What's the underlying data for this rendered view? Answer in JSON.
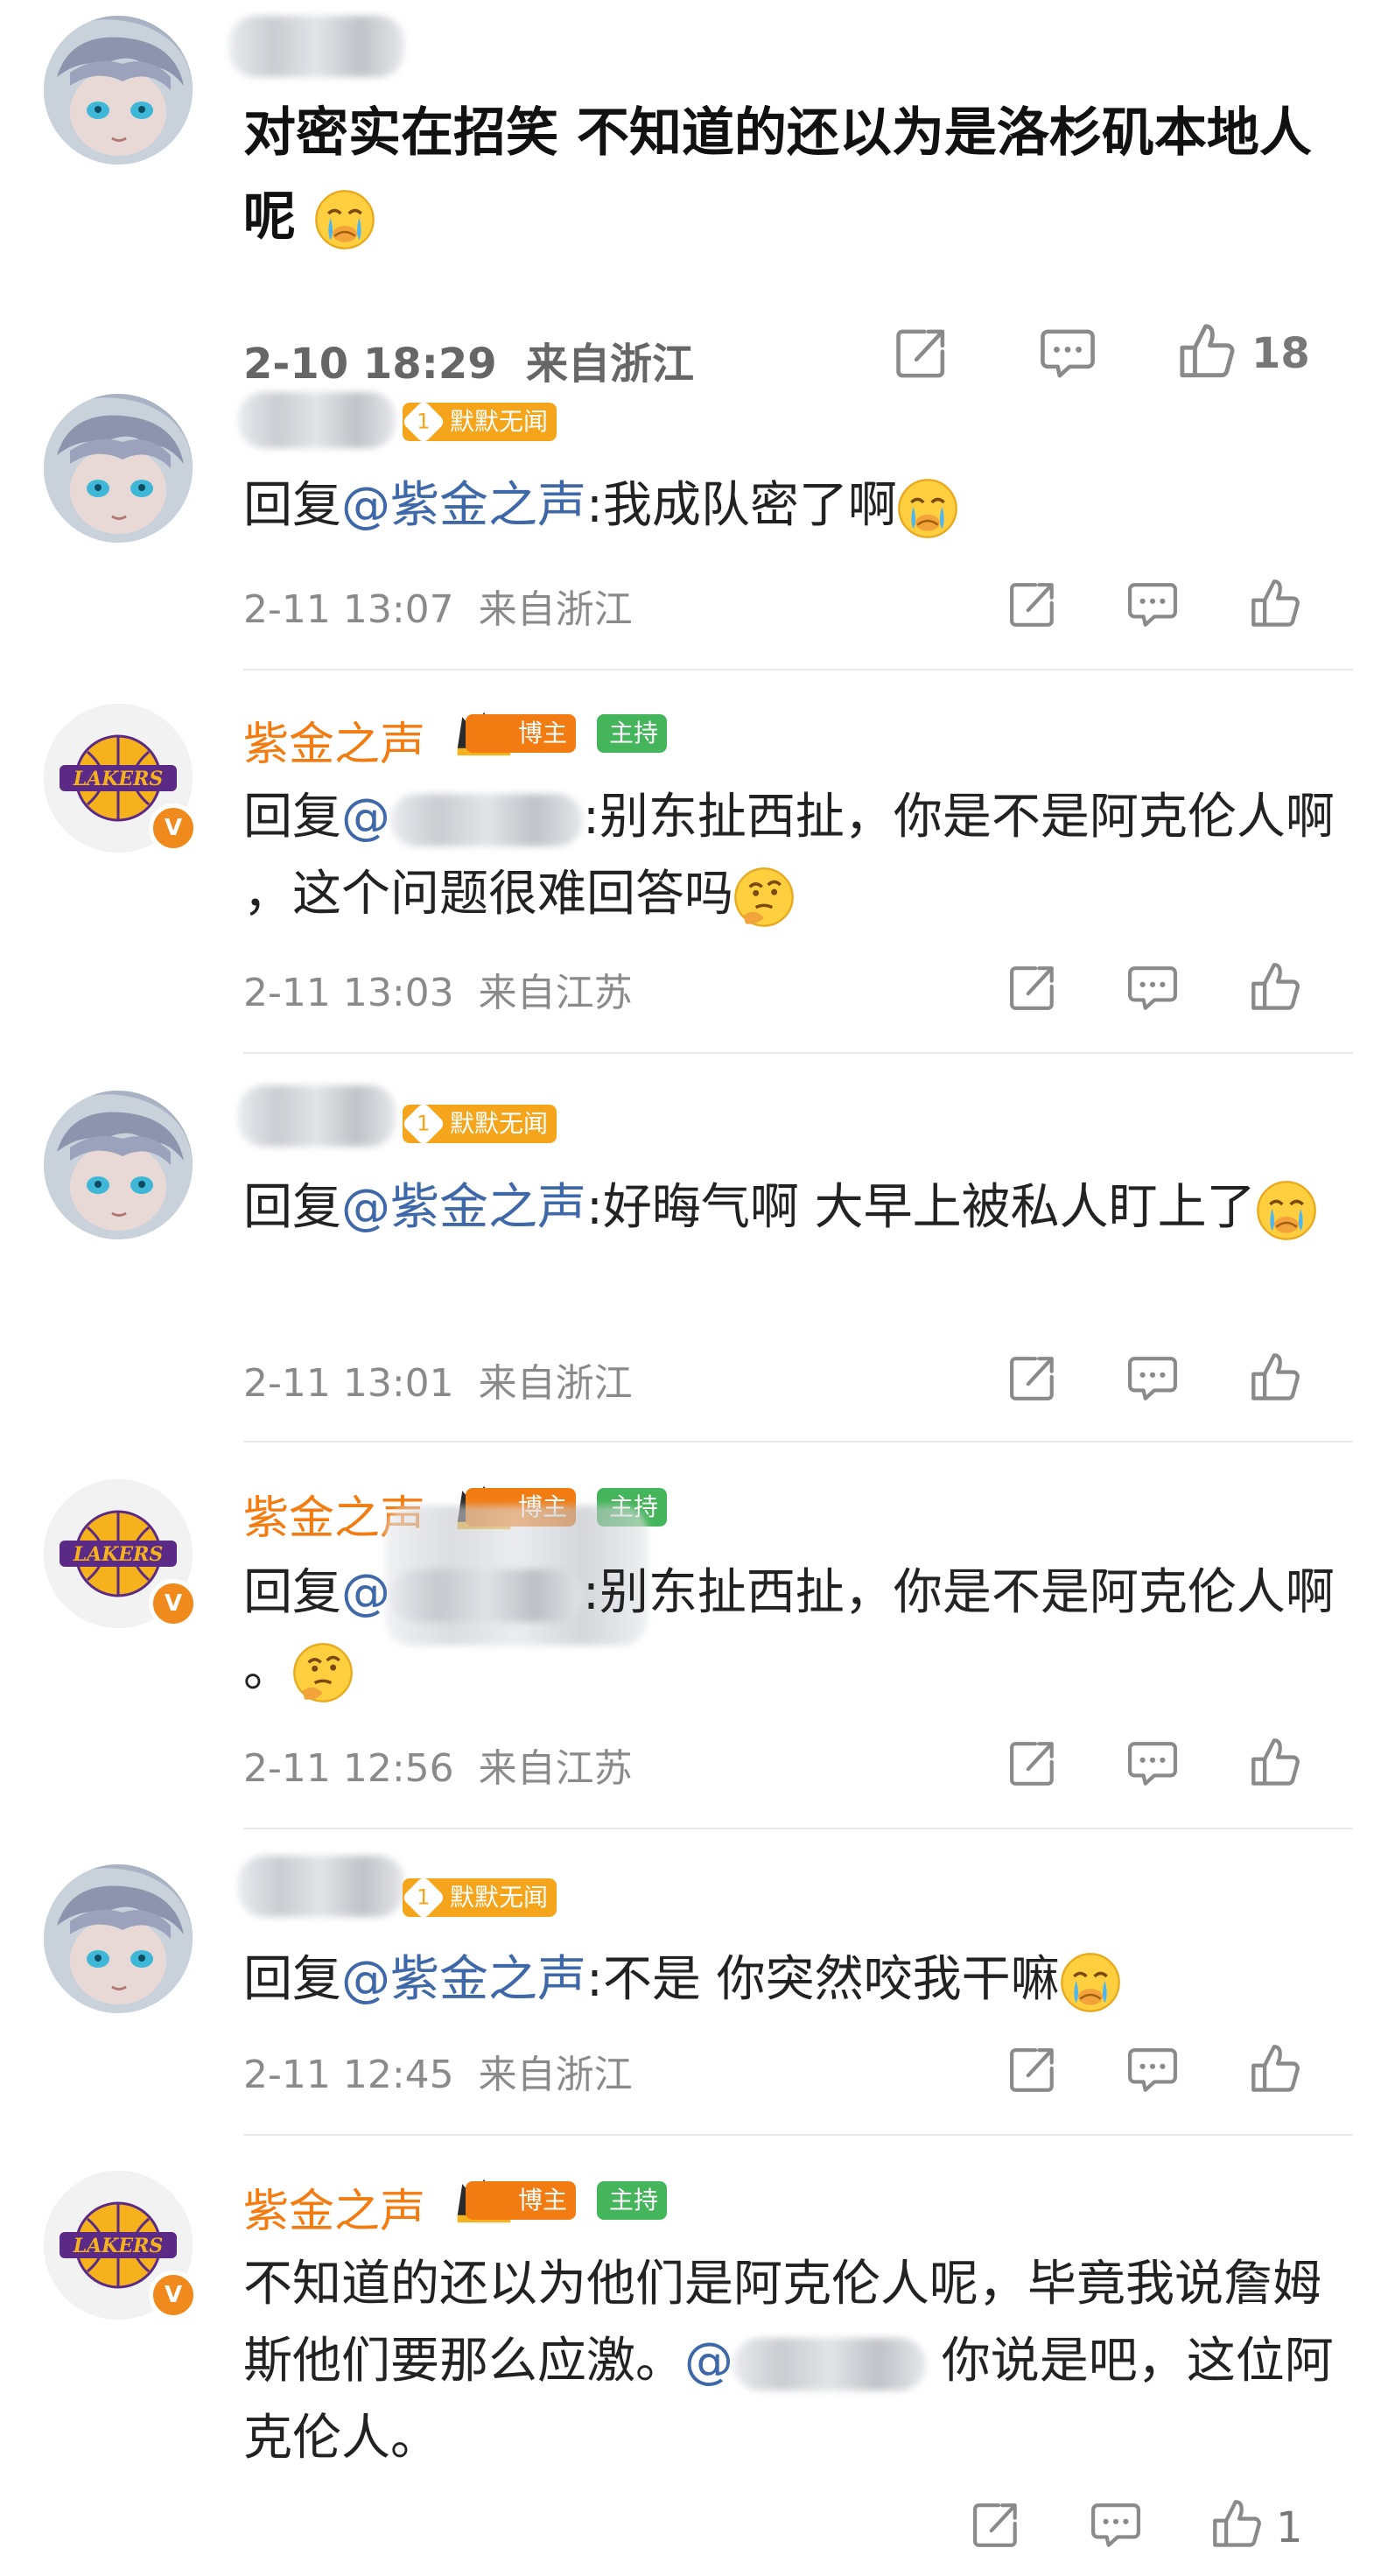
{
  "top_comment": {
    "text": "对密实在招笑 不知道的还以为是洛杉矶本地人呢",
    "time": "2-10 18:29",
    "location": "来自浙江",
    "likes": "18",
    "icons": [
      "share-icon",
      "comment-icon",
      "like-icon",
      "crying-emoji"
    ]
  },
  "badges": {
    "silent": "默默无闻",
    "host": "博主",
    "moderator": "主持",
    "level": "1",
    "verified": "V"
  },
  "replies": [
    {
      "user": "",
      "reply_prefix": "回复",
      "mention": "@紫金之声",
      "text": ":我成队密了啊",
      "time": "2-11 13:07",
      "location": "来自浙江"
    },
    {
      "user": "紫金之声",
      "reply_prefix": "回复",
      "mention": "@",
      "text": ":别东扯西扯，你是不是阿克伦人啊 ，这个问题很难回答吗",
      "time": "2-11 13:03",
      "location": "来自江苏"
    },
    {
      "user": "",
      "reply_prefix": "回复",
      "mention": "@紫金之声",
      "text": ":好晦气啊 大早上被私人盯上了",
      "time": "2-11 13:01",
      "location": "来自浙江"
    },
    {
      "user": "紫金之声",
      "reply_prefix": "回复",
      "mention": "@",
      "text": ":别东扯西扯，你是不是阿克伦人啊 。",
      "time": "2-11 12:56",
      "location": "来自江苏"
    },
    {
      "user": "",
      "reply_prefix": "回复",
      "mention": "@紫金之声",
      "text": ":不是 你突然咬我干嘛",
      "time": "2-11 12:45",
      "location": "来自浙江"
    },
    {
      "user": "紫金之声",
      "text_a": "不知道的还以为他们是阿克伦人呢，毕竟我说詹姆斯他们要那么应激。",
      "mention": "@",
      "text_b": " 你说是吧，这位阿克伦人。",
      "likes": "1"
    }
  ],
  "colors": {
    "username": "#f27c12",
    "mention": "#3f68a8",
    "meta": "#8a8a8a",
    "host_badge": "#f27c12",
    "moderator_badge": "#44b55a",
    "silent_badge": "#f5a51c"
  }
}
